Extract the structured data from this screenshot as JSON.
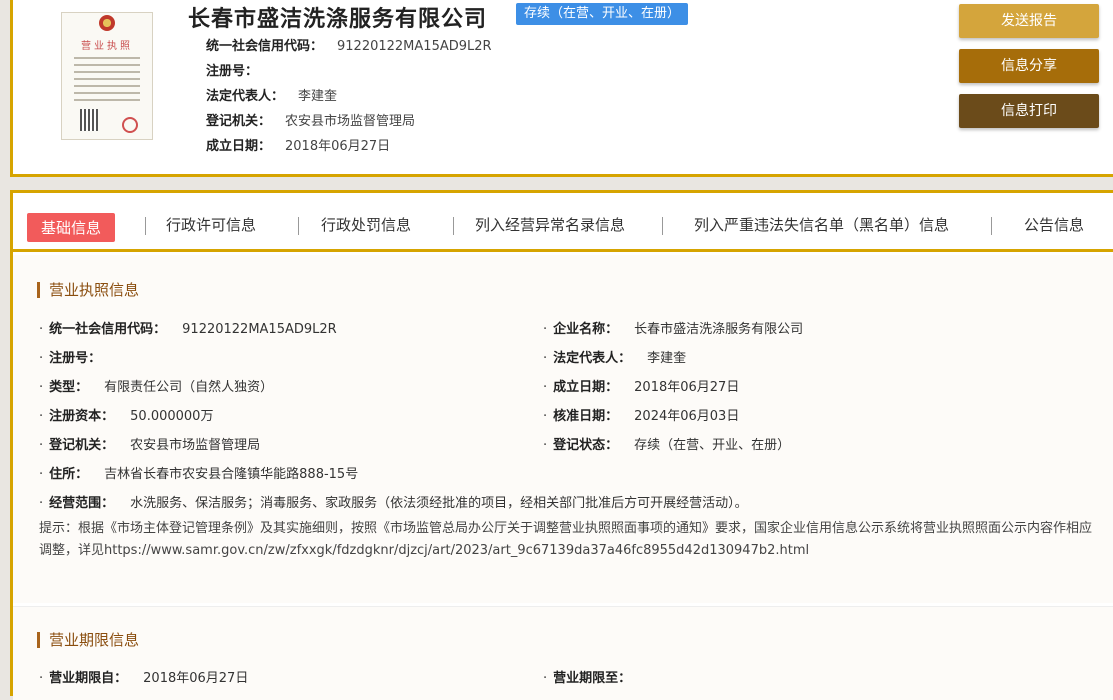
{
  "company": {
    "name": "长春市盛洁洗涤服务有限公司",
    "status": "存续（在营、开业、在册）",
    "license_title": "营业执照",
    "fields": [
      {
        "label": "统一社会信用代码：",
        "value": "91220122MA15AD9L2R"
      },
      {
        "label": "注册号：",
        "value": ""
      },
      {
        "label": "法定代表人：",
        "value": "李建奎"
      },
      {
        "label": "登记机关：",
        "value": "农安县市场监督管理局"
      },
      {
        "label": "成立日期：",
        "value": "2018年06月27日"
      }
    ]
  },
  "actions": {
    "report": "发送报告",
    "share": "信息分享",
    "print": "信息打印"
  },
  "tabs": [
    {
      "label": "基础信息",
      "active": true
    },
    {
      "label": "行政许可信息"
    },
    {
      "label": "行政处罚信息"
    },
    {
      "label": "列入经营异常名录信息"
    },
    {
      "label": "列入严重违法失信名单（黑名单）信息"
    },
    {
      "label": "公告信息"
    }
  ],
  "license_section": {
    "title": "营业执照信息",
    "left": [
      {
        "label": "统一社会信用代码：",
        "value": "91220122MA15AD9L2R"
      },
      {
        "label": "注册号：",
        "value": ""
      },
      {
        "label": "类型：",
        "value": "有限责任公司（自然人独资）"
      },
      {
        "label": "注册资本：",
        "value": "50.000000万"
      },
      {
        "label": "登记机关：",
        "value": "农安县市场监督管理局"
      },
      {
        "label": "住所：",
        "value": "吉林省长春市农安县合隆镇华能路888-15号"
      },
      {
        "label": "经营范围：",
        "value": "水洗服务、保洁服务；消毒服务、家政服务（依法须经批准的项目，经相关部门批准后方可开展经营活动）。"
      }
    ],
    "right": [
      {
        "label": "企业名称：",
        "value": "长春市盛洁洗涤服务有限公司"
      },
      {
        "label": "法定代表人：",
        "value": "李建奎"
      },
      {
        "label": "成立日期：",
        "value": "2018年06月27日"
      },
      {
        "label": "核准日期：",
        "value": "2024年06月03日"
      },
      {
        "label": "登记状态：",
        "value": "存续（在营、开业、在册）"
      }
    ],
    "notice": "提示：根据《市场主体登记管理条例》及其实施细则，按照《市场监管总局办公厅关于调整营业执照照面事项的通知》要求，国家企业信用信息公示系统将营业执照照面公示内容作相应调整，详见https://www.samr.gov.cn/zw/zfxxgk/fdzdgknr/djzcj/art/2023/art_9c67139da37a46fc8955d42d130947b2.html"
  },
  "period_section": {
    "title": "营业期限信息",
    "from_label": "营业期限自：",
    "from_value": "2018年06月27日",
    "to_label": "营业期限至：",
    "to_value": ""
  }
}
